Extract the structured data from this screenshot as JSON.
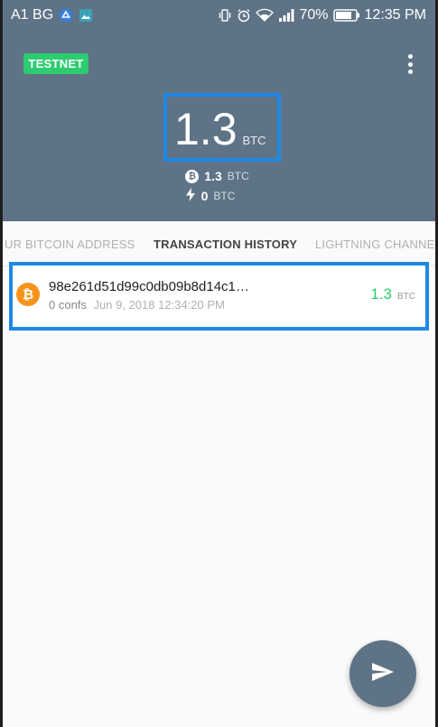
{
  "status_bar": {
    "carrier": "A1 BG",
    "battery": "70%",
    "time": "12:35 PM"
  },
  "header": {
    "network_badge": "TESTNET",
    "balance_amount": "1.3",
    "balance_unit": "BTC",
    "onchain_amount": "1.3",
    "onchain_unit": "BTC",
    "lightning_amount": "0",
    "lightning_unit": "BTC"
  },
  "tabs": [
    {
      "label": "UR BITCOIN ADDRESS"
    },
    {
      "label": "TRANSACTION HISTORY"
    },
    {
      "label": "LIGHTNING CHANNELS"
    }
  ],
  "transactions": [
    {
      "hash": "98e261d51d99c0db09b8d14c1…",
      "confs": "0 confs",
      "date": "Jun 9, 2018 12:34:20 PM",
      "amount": "1.3",
      "unit": "BTC"
    }
  ],
  "colors": {
    "header": "#5f7386",
    "accent_green": "#2ecc71",
    "bitcoin_orange": "#f7931a",
    "highlight_blue": "#1e88e5"
  },
  "icons": {
    "fab": "send-icon",
    "menu": "more-vert-icon"
  }
}
